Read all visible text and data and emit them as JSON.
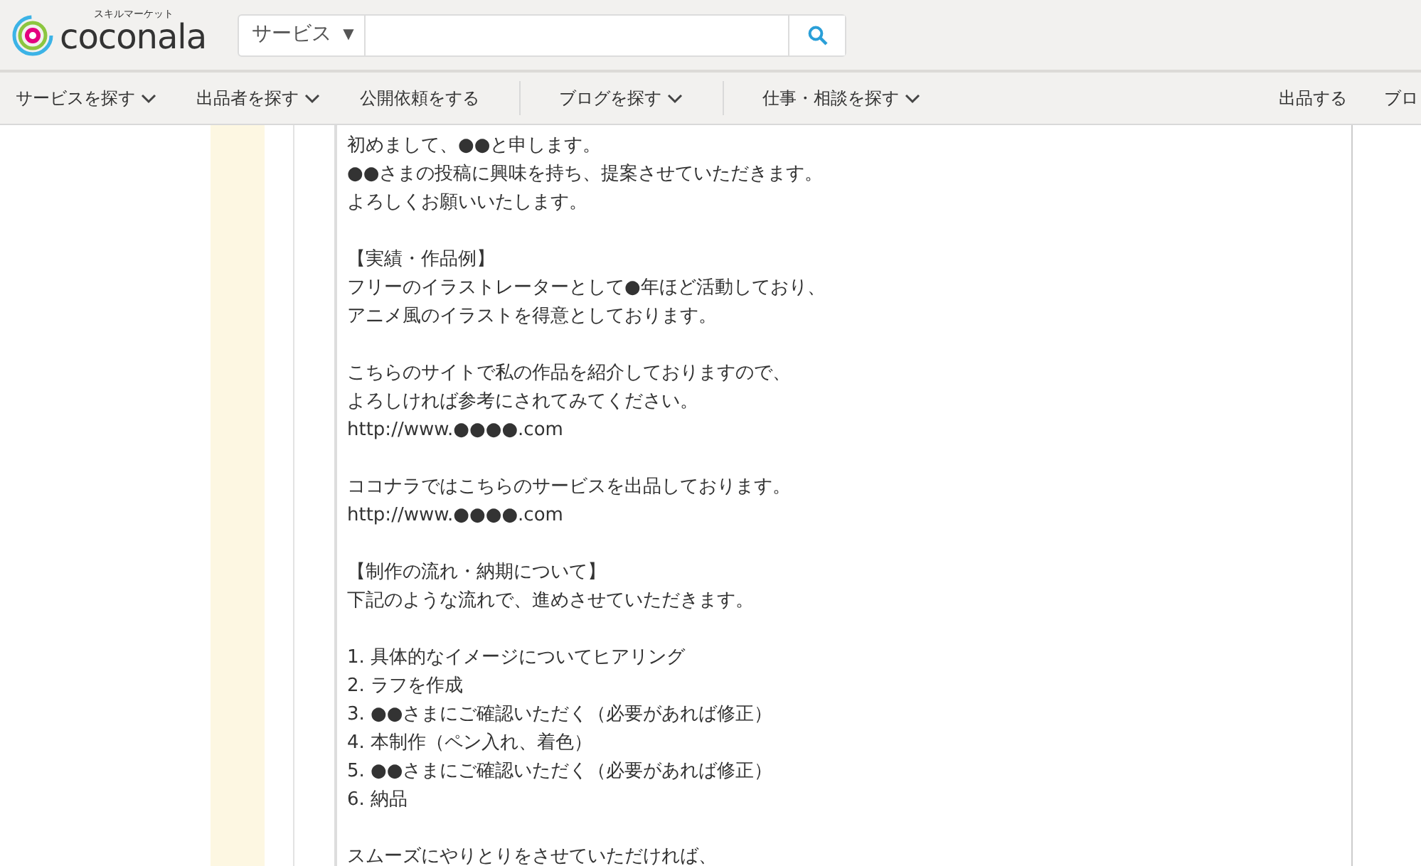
{
  "logo": {
    "tagline": "スキルマーケット",
    "name": "coconala"
  },
  "search": {
    "category": "サービス",
    "caret": "▼"
  },
  "nav": {
    "items": [
      {
        "label": "サービスを探す",
        "has_menu": true,
        "divider_after": false
      },
      {
        "label": "出品者を探す",
        "has_menu": true,
        "divider_after": false
      },
      {
        "label": "公開依頼をする",
        "has_menu": false,
        "divider_after": true
      },
      {
        "label": "ブログを探す",
        "has_menu": true,
        "divider_after": true
      },
      {
        "label": "仕事・相談を探す",
        "has_menu": true,
        "divider_after": false
      }
    ],
    "right_items": [
      "出品する",
      "ブロ"
    ]
  },
  "message": {
    "paragraphs": [
      [
        "初めまして、●●と申します。",
        "●●さまの投稿に興味を持ち、提案させていただきます。",
        "よろしくお願いいたします。"
      ],
      [
        "【実績・作品例】",
        "フリーのイラストレーターとして●年ほど活動しており、",
        "アニメ風のイラストを得意としております。"
      ],
      [
        "こちらのサイトで私の作品を紹介しておりますので、",
        "よろしければ参考にされてみてください。",
        "http://www.●●●●.com"
      ],
      [
        "ココナラではこちらのサービスを出品しております。",
        "http://www.●●●●.com"
      ],
      [
        "【制作の流れ・納期について】",
        "下記のような流れで、進めさせていただきます。"
      ],
      [
        "1. 具体的なイメージについてヒアリング",
        "2. ラフを作成",
        "3. ●●さまにご確認いただく（必要があれば修正）",
        "4. 本制作（ペン入れ、着色）",
        "5. ●●さまにご確認いただく（必要があれば修正）",
        "6. 納品"
      ],
      [
        "スムーズにやりとりをさせていただければ、"
      ]
    ]
  }
}
